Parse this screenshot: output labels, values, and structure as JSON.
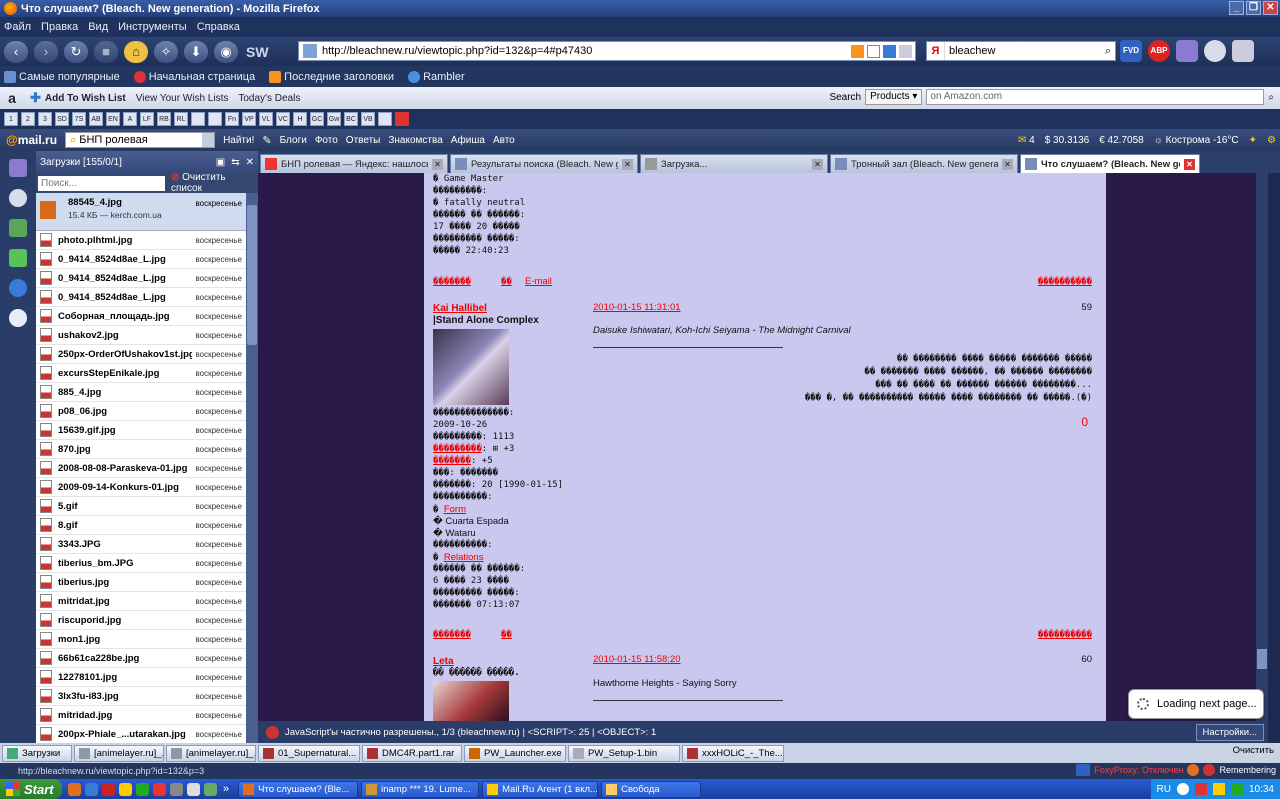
{
  "window": {
    "title": "Что слушаем? (Bleach. New generation) - Mozilla Firefox",
    "buttons": [
      "_",
      "❐",
      "✕"
    ]
  },
  "menu": [
    "Файл",
    "Правка",
    "Вид",
    "Инструменты",
    "Справка"
  ],
  "nav": {
    "url": "http://bleachnew.ru/viewtopic.php?id=132&p=4#p47430",
    "search_value": "bleachew",
    "sw_label": "SW",
    "fvd_label": "FVD",
    "abp_label": "ABP"
  },
  "bookmarks": [
    "Самые популярные",
    "Начальная страница",
    "Последние заголовки",
    "Rambler"
  ],
  "amazon": {
    "logo": "a",
    "add_to_wishlist": "Add To Wish List",
    "view_wishlists": "View Your Wish Lists",
    "todays_deals": "Today's Deals",
    "search_label": "Search",
    "products": "Products ▾",
    "placeholder": "on Amazon.com"
  },
  "tinybar": [
    "1",
    "2",
    "3",
    "SD",
    "7S",
    "AB",
    "EN",
    "A",
    "LF",
    "RB",
    "RL",
    "",
    "",
    "Fn",
    "VP",
    "VL",
    "VC",
    "H",
    "GC",
    "Gw",
    "BC",
    "VB",
    ""
  ],
  "mailbar": {
    "logo_at": "@",
    "logo_text": "mail.ru",
    "search_value": "БНП ролевая",
    "find": "Найти!",
    "links": [
      "Блоги",
      "Фото",
      "Ответы",
      "Знакомства",
      "Афиша",
      "Авто"
    ],
    "mail_count": "4",
    "usd": "30.3136",
    "eur": "42.7058",
    "weather": "Кострома -16°C"
  },
  "downloads": {
    "header": "Загрузки [155/0/1]",
    "search_placeholder": "Поиск...",
    "clear_label": "Очистить список",
    "first": {
      "name": "88545_4.jpg",
      "info": "15.4 КБ — kerch.com.ua",
      "date": "воскресенье"
    },
    "items": [
      {
        "name": "photo.plhtml.jpg",
        "date": "воскресенье"
      },
      {
        "name": "0_9414_8524d8ae_L.jpg",
        "date": "воскресенье"
      },
      {
        "name": "0_9414_8524d8ae_L.jpg",
        "date": "воскресенье"
      },
      {
        "name": "0_9414_8524d8ae_L.jpg",
        "date": "воскресенье"
      },
      {
        "name": "Соборная_площадь.jpg",
        "date": "воскресенье"
      },
      {
        "name": "ushakov2.jpg",
        "date": "воскресенье"
      },
      {
        "name": "250px-OrderOfUshakov1st.jpg",
        "date": "воскресенье"
      },
      {
        "name": "excursStepEnikale.jpg",
        "date": "воскресенье"
      },
      {
        "name": "885_4.jpg",
        "date": "воскресенье"
      },
      {
        "name": "p08_06.jpg",
        "date": "воскресенье"
      },
      {
        "name": "15639.gif.jpg",
        "date": "воскресенье"
      },
      {
        "name": "870.jpg",
        "date": "воскресенье"
      },
      {
        "name": "2008-08-08-Paraskeva-01.jpg",
        "date": "воскресенье"
      },
      {
        "name": "2009-09-14-Konkurs-01.jpg",
        "date": "воскресенье"
      },
      {
        "name": "5.gif",
        "date": "воскресенье"
      },
      {
        "name": "8.gif",
        "date": "воскресенье"
      },
      {
        "name": "3343.JPG",
        "date": "воскресенье"
      },
      {
        "name": "tiberius_bm.JPG",
        "date": "воскресенье"
      },
      {
        "name": "tiberius.jpg",
        "date": "воскресенье"
      },
      {
        "name": "mitridat.jpg",
        "date": "воскресенье"
      },
      {
        "name": "riscuporid.jpg",
        "date": "воскресенье"
      },
      {
        "name": "mon1.jpg",
        "date": "воскресенье"
      },
      {
        "name": "66b61ca228be.jpg",
        "date": "воскресенье"
      },
      {
        "name": "12278101.jpg",
        "date": "воскресенье"
      },
      {
        "name": "3lx3fu-i83.jpg",
        "date": "воскресенье"
      },
      {
        "name": "mitridad.jpg",
        "date": "воскресенье"
      },
      {
        "name": "200px-Phiale_...utarakan.jpg",
        "date": "воскресенье"
      }
    ]
  },
  "tabs": [
    {
      "label": "БНП ролевая — Яндекс: нашлось 21 ...",
      "color": "#e33"
    },
    {
      "label": "Результаты поиска (Bleach. New gen...",
      "color": "#7a8cb8"
    },
    {
      "label": "Загрузка...",
      "color": "#999"
    },
    {
      "label": "Тронный зал (Bleach. New generation)",
      "color": "#7a8cb8"
    },
    {
      "label": "Что слушаем? (Bleach. New gene...",
      "color": "#7a8cb8",
      "active": true
    }
  ],
  "forum": {
    "top_lines": [
      "� Game Master",
      "���������:",
      "� fatally neutral",
      "������ �� ������:",
      "17 ���� 20 �����",
      "��������� �����:",
      "����� 22:40:23"
    ],
    "links1": {
      "a": "�������",
      "b": "��",
      "c": "E-mail",
      "right": "����������"
    },
    "post1": {
      "author": "Kai Hallibel",
      "status": "|Stand Alone Complex",
      "date": "2010-01-15 11:31:01",
      "num": "59",
      "song": "Daisuke Ishiwatari, Koh-Ichi Seiyama - The Midnight Carnival",
      "text": [
        "�� �������� ���� ����� ������� �����",
        "�� ������� ���� ������, �� ������ ��������",
        "��� �� ���� �� ������ ������ ��������...",
        "��� �, �� ���������� ����� ���� �������� �� �����.(�)"
      ],
      "rating": "0",
      "info": {
        "reg_label": "��������������:",
        "reg_date": "2009-10-26",
        "msgs": "���������: 1113",
        "rep_link": "���������",
        "rep_val": ": ⊞ +3",
        "pos_link": "�������",
        "pos_val": ": +5",
        "sex": "���: �������",
        "age": "�������: 20 [1990-01-15]",
        "char_label": "����������:",
        "form": "Form",
        "espada": "� Cuarta Espada",
        "wataru": "� Wataru",
        "char2_label": "����������:",
        "relations": "Relations",
        "online_label": "������ �� ������:",
        "online_val": "6 ���� 23 ����",
        "last_label": "��������� �����:",
        "last_val": "������� 07:13:07"
      }
    },
    "links2": {
      "a": "�������",
      "b": "��",
      "right": "����������"
    },
    "post2": {
      "author": "Leta",
      "status": "�� ������ �����.",
      "date": "2010-01-15 11:58:20",
      "num": "60",
      "song": "Hawthorne Heights - Saying Sorry"
    }
  },
  "loading": "Loading next page...",
  "noscript": {
    "text": "JavaScript'ы частично разрешены., 1/3 (bleachnew.ru) | <SCRIPT>: 25 | <OBJECT>: 1",
    "settings": "Настройки..."
  },
  "dlbar": {
    "items": [
      "Загрузки",
      "[animelayer.ru]_...",
      "[animelayer.ru]_...",
      "01_Supernatural...",
      "DMC4R.part1.rar",
      "PW_Launcher.exe",
      "PW_Setup-1.bin",
      "xxxHOLiC_-_The..."
    ],
    "clear": "Очистить"
  },
  "status": {
    "url": "http://bleachnew.ru/viewtopic.php?id=132&p=3",
    "foxyproxy": "FoxyProxy: Отключен",
    "remembering": "Remembering"
  },
  "taskbar": {
    "start": "Start",
    "items": [
      "Что слушаем? (Ble...",
      "inamp *** 19. Lume...",
      "Mail.Ru Агент (1 вкл...",
      "Свобода"
    ],
    "lang": "RU",
    "clock": "10:34"
  }
}
